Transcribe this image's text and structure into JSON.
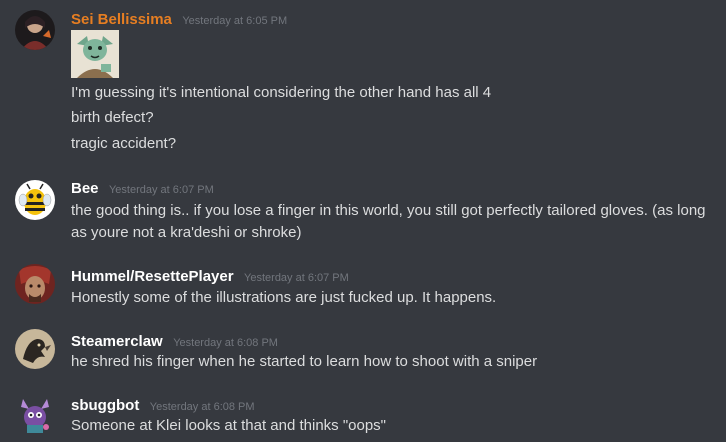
{
  "messages": [
    {
      "username": "Sei Bellissima",
      "username_color": "#e67e22",
      "timestamp": "Yesterday at 6:05 PM",
      "lines": [
        "I'm guessing it's intentional considering the other hand has all 4",
        "birth defect?",
        "tragic accident?"
      ]
    },
    {
      "username": "Bee",
      "username_color": "#ffffff",
      "timestamp": "Yesterday at 6:07 PM",
      "lines": [
        "the good thing is.. if you lose a finger in this world, you still got perfectly tailored gloves. (as long as youre not a kra'deshi or shroke)"
      ]
    },
    {
      "username": "Hummel/ResettePlayer",
      "username_color": "#ffffff",
      "timestamp": "Yesterday at 6:07 PM",
      "lines": [
        "Honestly some of the illustrations are just fucked up. It happens."
      ]
    },
    {
      "username": "Steamerclaw",
      "username_color": "#ffffff",
      "timestamp": "Yesterday at 6:08 PM",
      "lines": [
        "he shred his finger when he started to learn how to shoot with a sniper"
      ]
    },
    {
      "username": "sbuggbot",
      "username_color": "#ffffff",
      "timestamp": "Yesterday at 6:08 PM",
      "lines": [
        "Someone at Klei looks at that and thinks \"oops\""
      ]
    }
  ],
  "icons": {
    "avatar_1": "sei-bellissima-avatar-icon",
    "avatar_2": "bee-avatar-icon",
    "avatar_3": "hummel-avatar-icon",
    "avatar_4": "steamerclaw-avatar-icon",
    "avatar_5": "sbuggbot-avatar-icon",
    "attachment": "character-portrait-icon"
  }
}
